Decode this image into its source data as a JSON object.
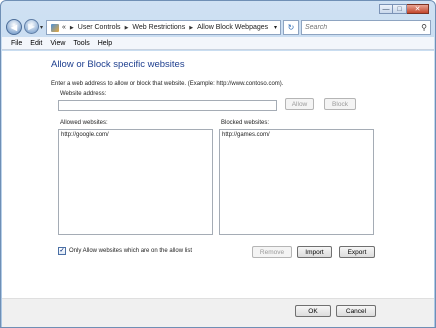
{
  "nav": {
    "back_glyph": "◀",
    "fwd_glyph": "▶",
    "dropdown_glyph": "▾",
    "refresh_glyph": "↻",
    "breadcrumb_prefix": "«",
    "breadcrumb_separator": "▶",
    "breadcrumbs": [
      "User Controls",
      "Web Restrictions",
      "Allow Block Webpages"
    ],
    "search_placeholder": "Search",
    "search_glyph": "⚲"
  },
  "window_buttons": {
    "minimize": "—",
    "maximize": "□",
    "close": "✕"
  },
  "menu": [
    "File",
    "Edit",
    "View",
    "Tools",
    "Help"
  ],
  "main": {
    "heading": "Allow or Block specific websites",
    "instructions": "Enter a web address to allow or block that website.  (Example: http://www.contoso.com).",
    "address_label": "Website address:",
    "address_value": "",
    "allow_button": "Allow",
    "block_button": "Block",
    "allowed_label": "Allowed websites:",
    "allowed_items": [
      "http://google.com/"
    ],
    "blocked_label": "Blocked websites:",
    "blocked_items": [
      "http://games.com/"
    ],
    "checkbox_checked": true,
    "checkbox_glyph": "✓",
    "checkbox_label": "Only Allow websites which are on the allow list",
    "remove_button": "Remove",
    "import_button": "Import",
    "export_button": "Export"
  },
  "footer": {
    "ok_button": "OK",
    "cancel_button": "Cancel"
  }
}
